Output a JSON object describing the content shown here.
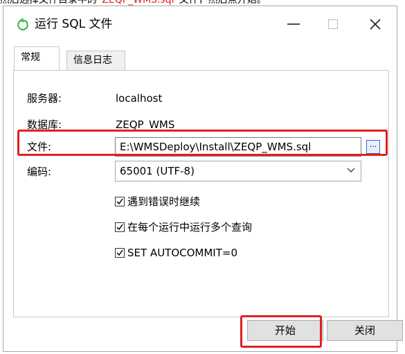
{
  "above_text": {
    "prefix": "然后选择文件目录中的",
    "highlight": "“ZEQP_WMS.sql”",
    "suffix": "文件，然后点开始。"
  },
  "window": {
    "title": "运行 SQL 文件",
    "controls": {
      "minimize": "—",
      "maximize": "□",
      "close": "✕"
    }
  },
  "tabs": [
    {
      "label": "常规"
    },
    {
      "label": "信息日志"
    }
  ],
  "form": {
    "server_label": "服务器:",
    "server_value": "localhost",
    "database_label": "数据库:",
    "database_value": "ZEQP_WMS",
    "file_label": "文件:",
    "file_value": "E:\\WMSDeploy\\Install\\ZEQP_WMS.sql",
    "browse_label": "...",
    "encoding_label": "编码:",
    "encoding_value": "65001 (UTF-8)"
  },
  "options": [
    {
      "label": "遇到错误时继续",
      "checked": true
    },
    {
      "label": "在每个运行中运行多个查询",
      "checked": true
    },
    {
      "label": "SET AUTOCOMMIT=0",
      "checked": true
    }
  ],
  "buttons": {
    "start": "开始",
    "close": "关闭"
  },
  "colors": {
    "highlight_red": "#e02020",
    "app_icon_green": "#2fb344",
    "browse_blue": "#2b6bd1"
  }
}
